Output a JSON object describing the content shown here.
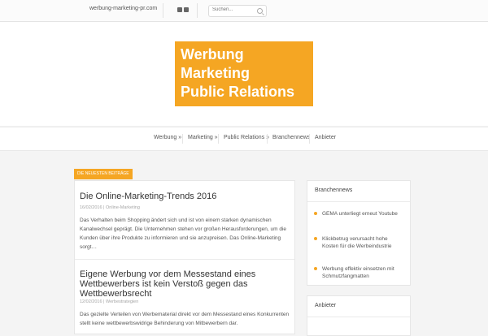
{
  "topbar": {
    "site_url": "werbung-marketing-pr.com",
    "search_placeholder": "Suchen...",
    "social_icons": [
      "twitter-icon",
      "rss-icon"
    ]
  },
  "logo": {
    "line1": "Werbung",
    "line2": "Marketing",
    "line3": "Public Relations",
    "bg_color": "#f5a623"
  },
  "nav": {
    "items": [
      {
        "label": "Werbung »"
      },
      {
        "label": "Marketing »"
      },
      {
        "label": "Public Relations »"
      },
      {
        "label": "Branchennews"
      },
      {
        "label": "Anbieter"
      }
    ]
  },
  "main": {
    "section_label": "Die neuesten Beiträge",
    "posts": [
      {
        "title": "Die Online-Marketing-Trends 2016",
        "date": "16/02/2016",
        "category": "Online-Marketing",
        "excerpt": "Das Verhalten beim Shopping ändert sich und ist von einem starken dynamischen Kanalwechsel geprägt. Die Unternehmen stehen vor großen Herausforderungen, um die Kunden über ihre Produkte zu informieren und sie anzupreisen. Das Online-Marketing sorgt…"
      },
      {
        "title": "Eigene Werbung vor dem Messestand eines Wettbewerbers ist kein Verstoß gegen das Wettbewerbsrecht",
        "date": "12/02/2016",
        "category": "Werbestrategien",
        "excerpt": "Das gezielte Verteilen von Werbematerial direkt vor dem Messestand eines Konkurrenten stellt keine wettbewerbswidrige Behinderung von Mitbewerbern dar."
      }
    ]
  },
  "sidebar": {
    "branchennews": {
      "title": "Branchennews",
      "items": [
        {
          "text": "GEMA unterliegt erneut Youtube"
        },
        {
          "text": "Klickbetrug verursacht hohe Kosten für die Werbeindustrie"
        },
        {
          "text": "Werbung effektiv einsetzen mit Schmutzfangmatten"
        }
      ]
    },
    "anbieter": {
      "title": "Anbieter"
    }
  },
  "colors": {
    "accent": "#f5a623"
  }
}
